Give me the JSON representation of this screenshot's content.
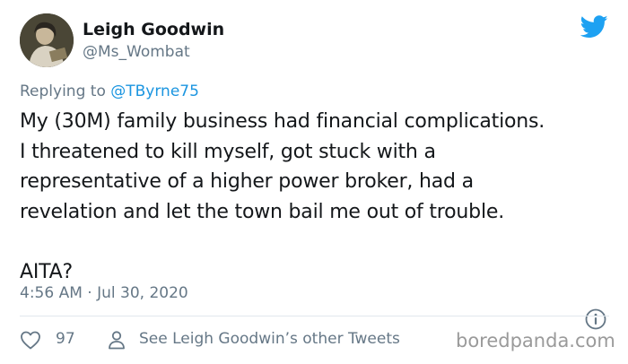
{
  "user": {
    "display_name": "Leigh Goodwin",
    "handle": "@Ms_Wombat"
  },
  "reply": {
    "prefix": "Replying to ",
    "mention": "@TByrne75"
  },
  "tweet": {
    "text": "My (30M) family business had financial complications.\nI threatened to kill myself, got stuck with a\nrepresentative of a higher power broker, had a\nrevelation and let the town bail me out of trouble.\n\nAITA?",
    "timestamp": "4:56 AM · Jul 30, 2020"
  },
  "actions": {
    "like_count": "97",
    "profile_link": "See Leigh Goodwin’s other Tweets"
  },
  "watermark": "boredpanda.com",
  "colors": {
    "twitter_blue": "#1da1f2",
    "secondary_text": "#657786",
    "link": "#1b95e0"
  },
  "icons": {
    "brand": "twitter-bird-icon",
    "info": "info-icon",
    "like": "heart-icon",
    "profile": "person-icon"
  }
}
